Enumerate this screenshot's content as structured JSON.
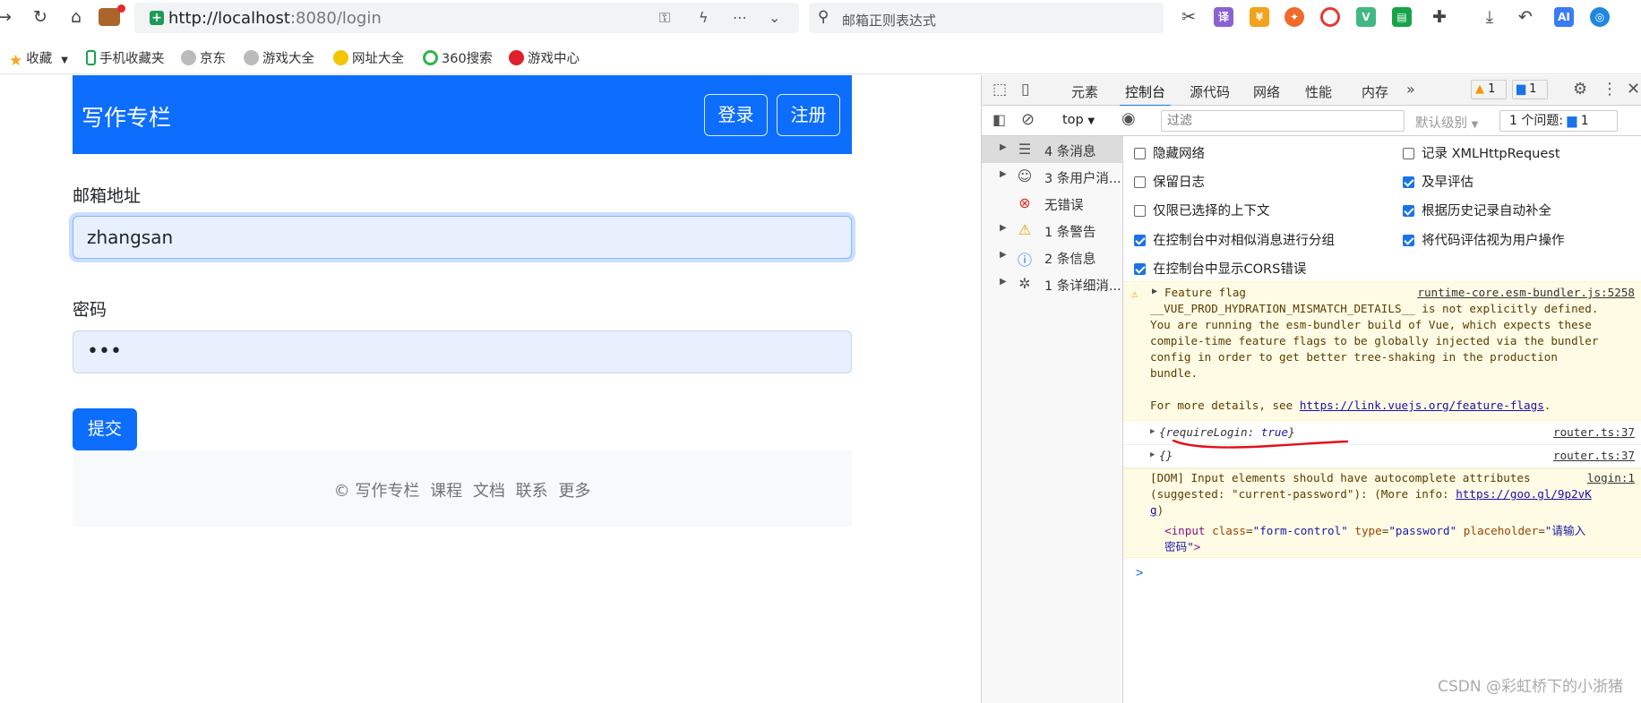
{
  "browser": {
    "url_host": "http://localhost",
    "url_path": ":8080/login",
    "search_placeholder": "邮箱正则表达式",
    "ext_labels": [
      "译",
      "AI"
    ],
    "bookmarks": [
      "收藏",
      "手机收藏夹",
      "京东",
      "游戏大全",
      "网址大全",
      "360搜索",
      "游戏中心"
    ]
  },
  "page": {
    "brand": "写作专栏",
    "login_button": "登录",
    "register_button": "注册",
    "email_label": "邮箱地址",
    "email_value": "zhangsan",
    "password_label": "密码",
    "password_value": "•••",
    "submit_label": "提交",
    "footer": {
      "copyright": "© 写作专栏",
      "links": [
        "课程",
        "文档",
        "联系",
        "更多"
      ]
    }
  },
  "devtools": {
    "tabs": [
      "元素",
      "控制台",
      "源代码",
      "网络",
      "性能",
      "内存"
    ],
    "active_tab": "控制台",
    "warn_count": "1",
    "info_count": "1",
    "context": "top",
    "filter_placeholder": "过滤",
    "level": "默认级别",
    "issues_label": "1 个问题:",
    "issues_count": "1",
    "sidebar": [
      {
        "label": "4 条消息",
        "icon": "list-icon"
      },
      {
        "label": "3 条用户消...",
        "icon": "user-icon"
      },
      {
        "label": "无错误",
        "icon": "error-icon"
      },
      {
        "label": "1 条警告",
        "icon": "warning-icon"
      },
      {
        "label": "2 条信息",
        "icon": "info-icon"
      },
      {
        "label": "1 条详细消...",
        "icon": "bug-icon"
      }
    ],
    "settings_left": [
      {
        "label": "隐藏网络",
        "checked": false
      },
      {
        "label": "保留日志",
        "checked": false
      },
      {
        "label": "仅限已选择的上下文",
        "checked": false
      },
      {
        "label": "在控制台中对相似消息进行分组",
        "checked": true
      },
      {
        "label": "在控制台中显示CORS错误",
        "checked": true
      }
    ],
    "settings_right": [
      {
        "label": "记录 XMLHttpRequest",
        "checked": false
      },
      {
        "label": "及早评估",
        "checked": true
      },
      {
        "label": "根据历史记录自动补全",
        "checked": true
      },
      {
        "label": "将代码评估视为用户操作",
        "checked": true
      }
    ],
    "console": {
      "warn1_lines": [
        "Feature flag",
        "__VUE_PROD_HYDRATION_MISMATCH_DETAILS__ is not explicitly defined.",
        "You are running the esm-bundler build of Vue, which expects these",
        "compile-time feature flags to be globally injected via the bundler",
        "config in order to get better tree-shaking in the production",
        "bundle.",
        "",
        "For more details, see"
      ],
      "warn1_link": "https://link.vuejs.org/feature-flags",
      "warn1_link_suffix": ".",
      "warn1_source": "runtime-core.esm-bundler.js:5258",
      "log1_key": "requireLogin",
      "log1_value": "true",
      "log1_source": "router.ts:37",
      "log2_text": "{}",
      "log2_source": "router.ts:37",
      "warn2_lines": [
        "[DOM] Input elements should have autocomplete attributes",
        "(suggested: \"current-password\"): (More info: ",
        ")"
      ],
      "warn2_link_a": "https://goo.gl/9p2vK",
      "warn2_link_b": "g",
      "warn2_source": "login:1",
      "warn2_html_tag": "<input",
      "warn2_html_class": "form-control",
      "warn2_html_type": "password",
      "warn2_html_placeholder_a": "请输入",
      "warn2_html_placeholder_b": "密码",
      "prompt": ">"
    }
  },
  "watermark": "CSDN @彩虹桥下的小浙猪",
  "colors": {
    "primary": "#0d6efd",
    "input_bg": "#e8f0fe",
    "warn_bg": "#fffbe5",
    "annotation": "#e0101a"
  }
}
